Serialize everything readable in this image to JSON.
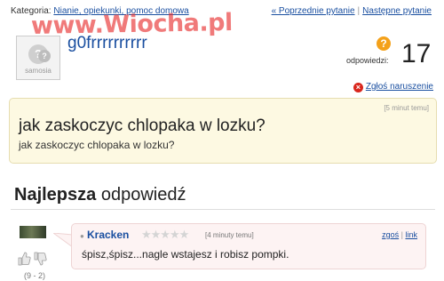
{
  "breadcrumb": {
    "label": "Kategoria:",
    "category": "Nianie, opiekunki, pomoc domowa"
  },
  "question_nav": {
    "previous": "« Poprzednie pytanie",
    "separator": "|",
    "next": "Następne pytanie"
  },
  "watermark": "www.Wiocha.pl",
  "avatar": {
    "brand": "samosia",
    "mark": "?"
  },
  "user": {
    "name": "g0frrrrrrrrrr"
  },
  "answers": {
    "icon": "question-icon",
    "label": "odpowiedzi:",
    "count": "17"
  },
  "report": {
    "label": "Zgłoś naruszenie"
  },
  "question": {
    "time": "[5 minut temu]",
    "title": "jak zaskoczyc chlopaka w lozku?",
    "body": "jak zaskoczyc chlopaka w lozku?"
  },
  "best_answer": {
    "heading_bold": "Najlepsza",
    "heading_rest": " odpowiedź",
    "user": "Kracken",
    "stars": "★★★★★",
    "rating": 0,
    "time": "[4 minuty temu]",
    "link_good": "zgoś",
    "link_sep": "|",
    "link_link": "link",
    "text": "śpisz,śpisz...nagle wstajesz i robisz pompki.",
    "votes": "(9 - 2)"
  },
  "colors": {
    "link": "#1a4fa0",
    "question_bg": "#fdf9e2",
    "answer_bg": "#fdf3f3",
    "report": "#d9261c",
    "badge": "#f4a11a"
  }
}
